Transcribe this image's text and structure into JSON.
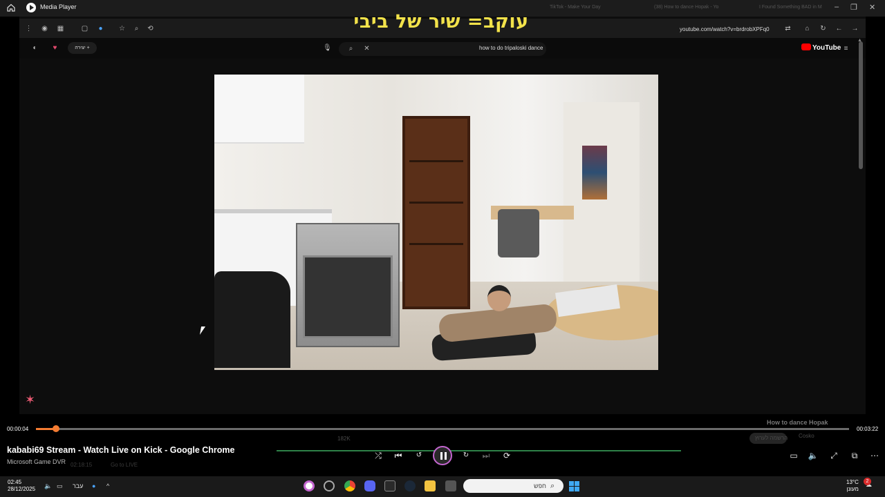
{
  "window": {
    "app_title": "Media Player",
    "ghost_tabs": [
      "TikTok - Make Your Day",
      "(38) How to dance Hopak - Yo",
      "I Found Something BAD in M"
    ]
  },
  "browser": {
    "url": "youtube.com/watch?v=brdrobXPFq0",
    "overlay_text": "עוקב= שיר של ביבי",
    "search_query": "how to do tripaloski dance",
    "create_label": "יצירה",
    "youtube_logo": "YouTube"
  },
  "player": {
    "elapsed": "00:00:04",
    "duration": "00:03:22",
    "progress_fraction": 0.025,
    "media_title": "kababi69 Stream - Watch Live on Kick - Google Chrome",
    "media_source": "Microsoft Game DVR",
    "ghost_video_title": "How to dance Hopak",
    "ghost_time": "02:18:15",
    "ghost_live": "Go to LIVE",
    "ghost_likes": "182K",
    "ghost_channel": "Cosko",
    "ghost_subscribe": "הרשמה לערוץ"
  },
  "colors": {
    "accent": "#f47c32",
    "play_ring": "#c466d0",
    "overlay_text": "#f2e24a",
    "kick_green": "#3aa35a"
  },
  "icons": [
    "home-icon",
    "media-player-icon",
    "shuffle-icon",
    "previous-icon",
    "rewind-10-icon",
    "pause-icon",
    "forward-30-icon",
    "next-icon",
    "repeat-off-icon",
    "captions-icon",
    "volume-icon",
    "fullscreen-icon",
    "mini-player-icon",
    "more-icon"
  ],
  "taskbar": {
    "time": "02:45",
    "date": "28/12/2025",
    "language": "עבר",
    "search_placeholder": "חפש",
    "temperature": "13°C",
    "weather_desc": "מעונן",
    "notification_count": "2"
  }
}
